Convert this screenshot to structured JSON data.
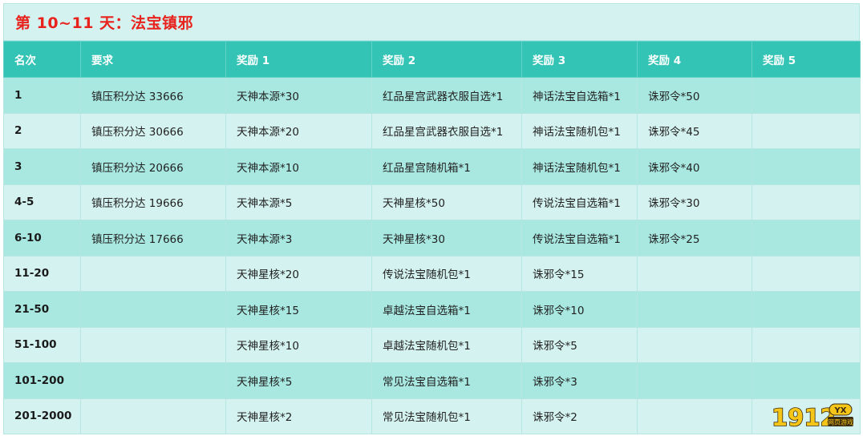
{
  "title": "第 10~11 天：法宝镇邪",
  "headers": [
    "名次",
    "要求",
    "奖励 1",
    "奖励 2",
    "奖励 3",
    "奖励 4",
    "奖励 5"
  ],
  "rows": [
    [
      "1",
      "镇压积分达 33666",
      "天神本源*30",
      "红品星宫武器衣服自选*1",
      "神话法宝自选箱*1",
      "诛邪令*50",
      ""
    ],
    [
      "2",
      "镇压积分达 30666",
      "天神本源*20",
      "红品星宫武器衣服自选*1",
      "神话法宝随机包*1",
      "诛邪令*45",
      ""
    ],
    [
      "3",
      "镇压积分达 20666",
      "天神本源*10",
      "红品星宫随机箱*1",
      "神话法宝随机包*1",
      "诛邪令*40",
      ""
    ],
    [
      "4-5",
      "镇压积分达 19666",
      "天神本源*5",
      "天神星核*50",
      "传说法宝自选箱*1",
      "诛邪令*30",
      ""
    ],
    [
      "6-10",
      "镇压积分达 17666",
      "天神本源*3",
      "天神星核*30",
      "传说法宝自选箱*1",
      "诛邪令*25",
      ""
    ],
    [
      "11-20",
      "",
      "天神星核*20",
      "传说法宝随机包*1",
      "诛邪令*15",
      "",
      ""
    ],
    [
      "21-50",
      "",
      "天神星核*15",
      "卓越法宝自选箱*1",
      "诛邪令*10",
      "",
      ""
    ],
    [
      "51-100",
      "",
      "天神星核*10",
      "卓越法宝随机包*1",
      "诛邪令*5",
      "",
      ""
    ],
    [
      "101-200",
      "",
      "天神星核*5",
      "常见法宝自选箱*1",
      "诛邪令*3",
      "",
      ""
    ],
    [
      "201-2000",
      "",
      "天神星核*2",
      "常见法宝随机包*1",
      "诛邪令*2",
      "",
      ""
    ]
  ],
  "watermark": {
    "brand": "1912",
    "badge": "YX",
    "sub": "网页游戏"
  },
  "colors": {
    "title": "#e8231e",
    "header_bg": "#34c4b6",
    "row_dark": "#a8e8e1",
    "row_light": "#d4f3f0",
    "border": "#b6e6e1"
  }
}
